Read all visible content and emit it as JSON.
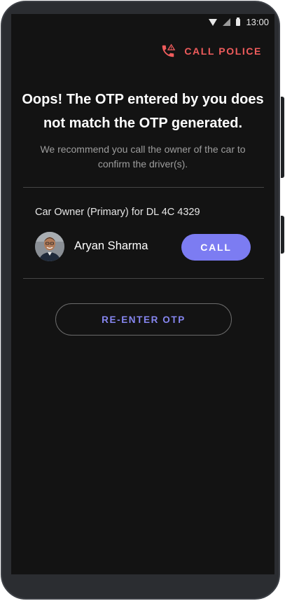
{
  "status_bar": {
    "time": "13:00",
    "icons": [
      "wifi-icon",
      "signal-icon",
      "battery-icon"
    ]
  },
  "header": {
    "call_police_label": "CALL POLICE",
    "icon": "phone-alert-icon",
    "accent_color": "#ef5c5c"
  },
  "main": {
    "headline_line1": "Oops! The OTP entered by you does",
    "headline_line2": "not match the OTP generated.",
    "subtext_line1": "We recommend you call the owner of the car to",
    "subtext_line2": "confirm the driver(s)."
  },
  "owner": {
    "label": "Car Owner (Primary) for DL 4C 4329",
    "name": "Aryan Sharma",
    "call_label": "CALL",
    "call_color": "#7c7cf2"
  },
  "actions": {
    "reenter_label": "RE-ENTER OTP"
  }
}
